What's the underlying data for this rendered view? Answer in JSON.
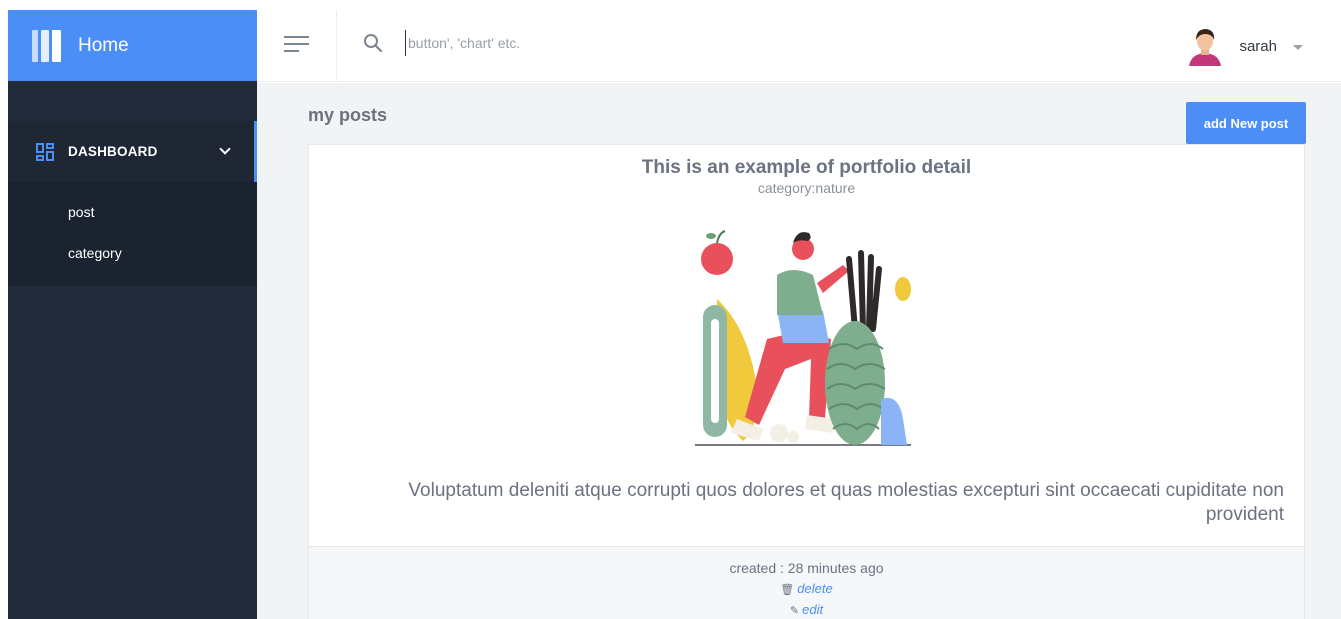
{
  "brand": {
    "title": "Home",
    "logo_icon": "columns-logo-icon"
  },
  "sidebar": {
    "section": {
      "label": "DASHBOARD",
      "icon": "dashboard-grid-icon",
      "expanded": true
    },
    "items": [
      {
        "label": "post"
      },
      {
        "label": "category"
      }
    ]
  },
  "topbar": {
    "menu_icon": "hamburger-icon",
    "search": {
      "icon": "search-icon",
      "placeholder": "button', 'chart' etc.",
      "value": ""
    },
    "user": {
      "name": "sarah",
      "avatar": "user-avatar"
    }
  },
  "main": {
    "title": "my posts",
    "add_button": "add New post",
    "post": {
      "title": "This is an example of portfolio detail",
      "category": "category:nature",
      "body": "Voluptatum deleniti atque corrupti quos dolores et quas molestias excepturi sint occaecati cupiditate non provident",
      "created": "created : 28 minutes ago",
      "delete_label": "delete",
      "edit_label": "edit",
      "delete_icon": "trash-icon",
      "edit_icon": "pencil-icon"
    }
  },
  "colors": {
    "accent": "#4b8ef6",
    "sidebar_bg": "#222b3a",
    "main_bg": "#f2f3f5"
  }
}
